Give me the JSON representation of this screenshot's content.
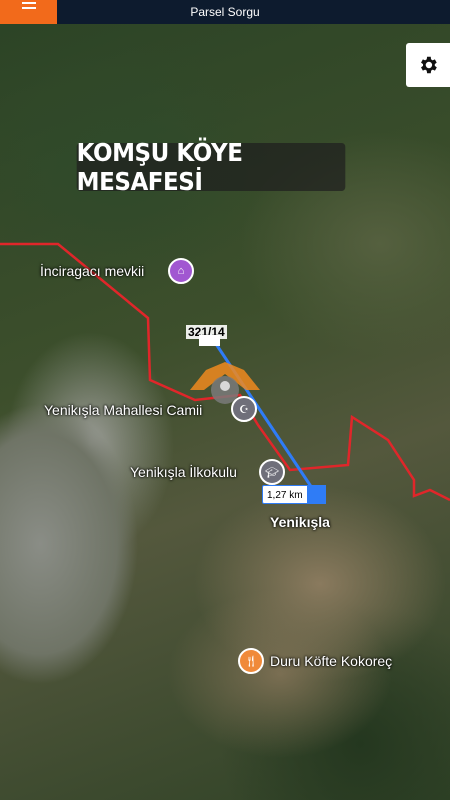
{
  "header": {
    "title": "Parsel Sorgu"
  },
  "banner": {
    "text": "KOMŞU KÖYE MESAFESİ"
  },
  "map": {
    "parcel_label": "321/14",
    "distance_label": "1,27 km",
    "place_name": "Yenikışla",
    "pois": [
      {
        "name": "İnciragacı mevkii",
        "icon": "landmark-icon",
        "color": "#a157d1"
      },
      {
        "name": "Yenikışla Mahallesi Camii",
        "icon": "mosque-icon",
        "color": "#6f6f7a"
      },
      {
        "name": "Yenikışla İlkokulu",
        "icon": "school-icon",
        "color": "#6f6f7a"
      },
      {
        "name": "Duru Köfte Kokoreç",
        "icon": "restaurant-icon",
        "color": "#f08a3a"
      }
    ]
  },
  "colors": {
    "topbar": "#0d1b2e",
    "menu_button": "#f26a1b",
    "boundary": "#e0262a",
    "route": "#2f7cf6"
  }
}
